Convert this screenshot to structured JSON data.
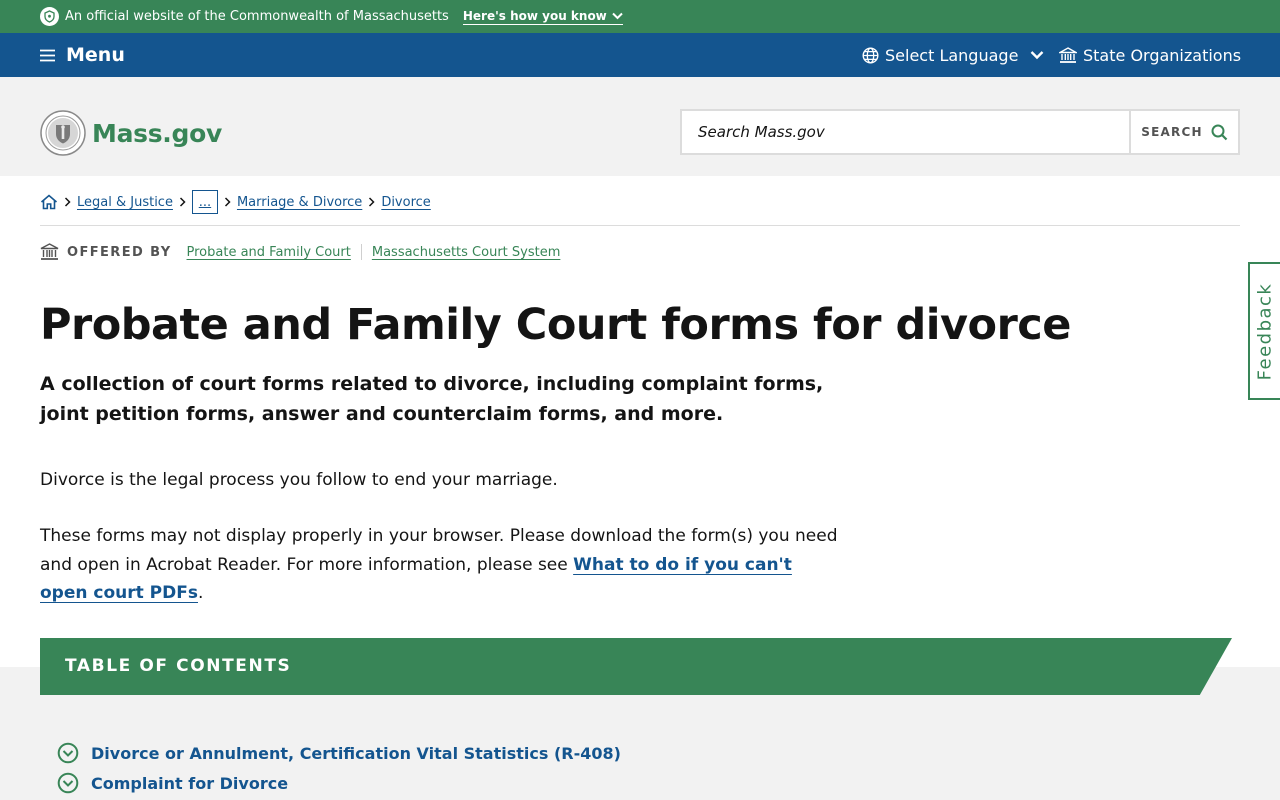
{
  "official_banner": {
    "text": "An official website of the Commonwealth of Massachusetts",
    "how_you_know": "Here's how you know"
  },
  "utility_nav": {
    "menu_label": "Menu",
    "language_label": "Select Language",
    "state_orgs_label": "State Organizations"
  },
  "header": {
    "logo_text": "Mass.gov",
    "search_placeholder": "Search Mass.gov",
    "search_button": "SEARCH"
  },
  "breadcrumb": {
    "items": [
      "Legal & Justice",
      "...",
      "Marriage & Divorce",
      "Divorce"
    ]
  },
  "offered_by": {
    "label": "OFFERED BY",
    "orgs": [
      "Probate and Family Court",
      "Massachusetts Court System"
    ]
  },
  "main": {
    "title": "Probate and Family Court forms for divorce",
    "lede": "A collection of court forms related to divorce, including complaint forms, joint petition forms, answer and counterclaim forms, and more.",
    "para1": "Divorce is the legal process you follow to end your marriage.",
    "para2_text": "These forms may not display properly in your browser. Please download the form(s) you need and open in Acrobat Reader. For more information, please see ",
    "para2_link": "What to do if you can't open court PDFs",
    "para2_end": "."
  },
  "feedback_label": "Feedback",
  "toc": {
    "title": "TABLE OF CONTENTS",
    "items": [
      "Divorce or Annulment, Certification Vital Statistics (R-408)",
      "Complaint for Divorce"
    ]
  },
  "colors": {
    "brand_green": "#388557",
    "brand_blue": "#14558f",
    "header_gray": "#f2f2f2"
  }
}
